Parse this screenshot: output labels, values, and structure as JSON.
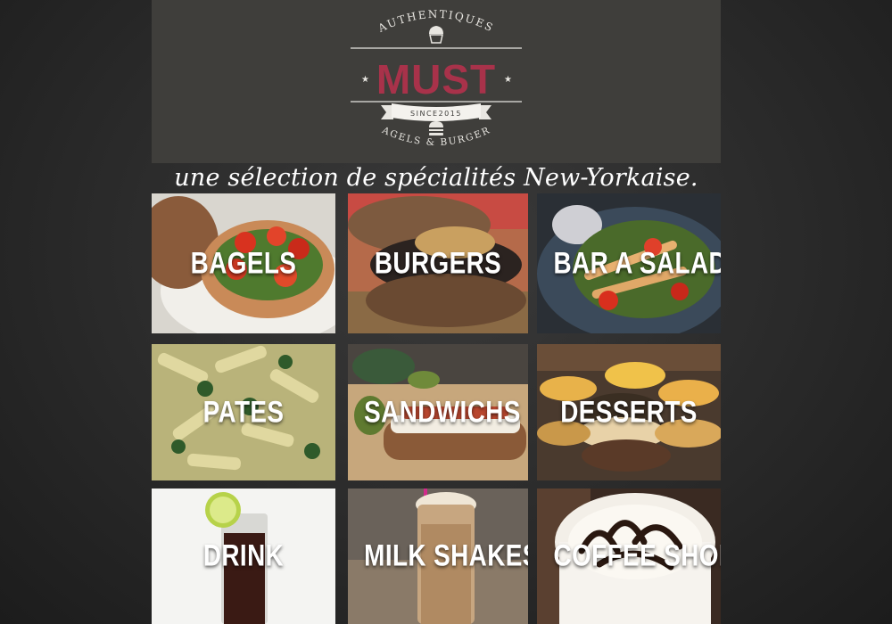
{
  "brand": {
    "top_text": "AUTHENTIQUES",
    "name": "MUST",
    "since": "SINCE2015",
    "bottom_text": "BAGELS & BURGERS",
    "name_color": "#a8324a",
    "line_color": "#e8e6e1"
  },
  "tagline": "une sélection de spécialités New-Yorkaise.",
  "menu": {
    "tiles": [
      {
        "label": "BAGELS"
      },
      {
        "label": "BURGERS"
      },
      {
        "label": "BAR A SALADE"
      },
      {
        "label": "PATES"
      },
      {
        "label": "SANDWICHS"
      },
      {
        "label": "DESSERTS"
      },
      {
        "label": "DRINK"
      },
      {
        "label": "MILK SHAKES"
      },
      {
        "label": "COFFEE SHOP"
      }
    ]
  }
}
